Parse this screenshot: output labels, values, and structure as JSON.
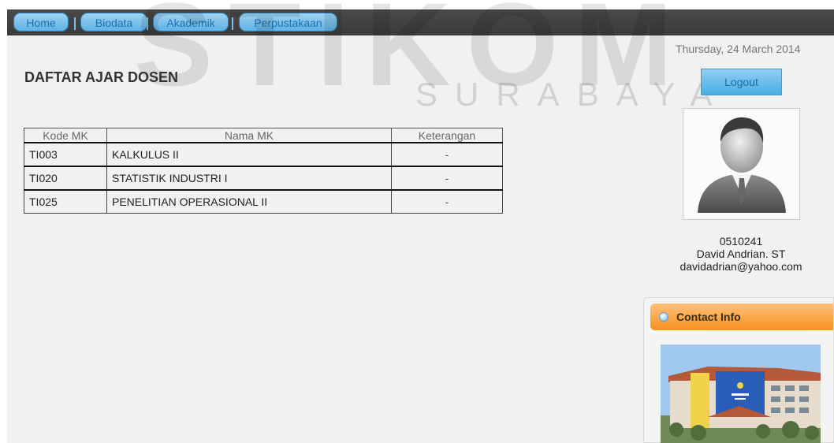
{
  "nav": {
    "items": [
      {
        "label": "Home"
      },
      {
        "label": "Biodata"
      },
      {
        "label": "Akademik"
      },
      {
        "label": "Perpustakaan"
      }
    ]
  },
  "watermark": {
    "big": "STIKOM",
    "small": "SURABAYA"
  },
  "header": {
    "date": "Thursday, 24 March 2014",
    "logout_label": "Logout"
  },
  "page": {
    "title": "DAFTAR AJAR DOSEN"
  },
  "table": {
    "columns": [
      "Kode MK",
      "Nama MK",
      "Keterangan"
    ],
    "rows": [
      {
        "kode": "TI003",
        "nama": "KALKULUS II",
        "keterangan": "-"
      },
      {
        "kode": "TI020",
        "nama": "STATISTIK INDUSTRI I",
        "keterangan": "-"
      },
      {
        "kode": "TI025",
        "nama": "PENELITIAN OPERASIONAL II",
        "keterangan": "-"
      }
    ]
  },
  "profile": {
    "id": "0510241",
    "name": "David Andrian. ST",
    "email": "davidadrian@yahoo.com",
    "avatar_icon": "user-silhouette-icon"
  },
  "sidebar": {
    "contact_title": "Contact Info"
  },
  "colors": {
    "nav_bg": "#3e3e3e",
    "nav_button": "#6bbbe9",
    "accent_orange": "#f7931e",
    "page_bg": "#f1f1f1"
  }
}
